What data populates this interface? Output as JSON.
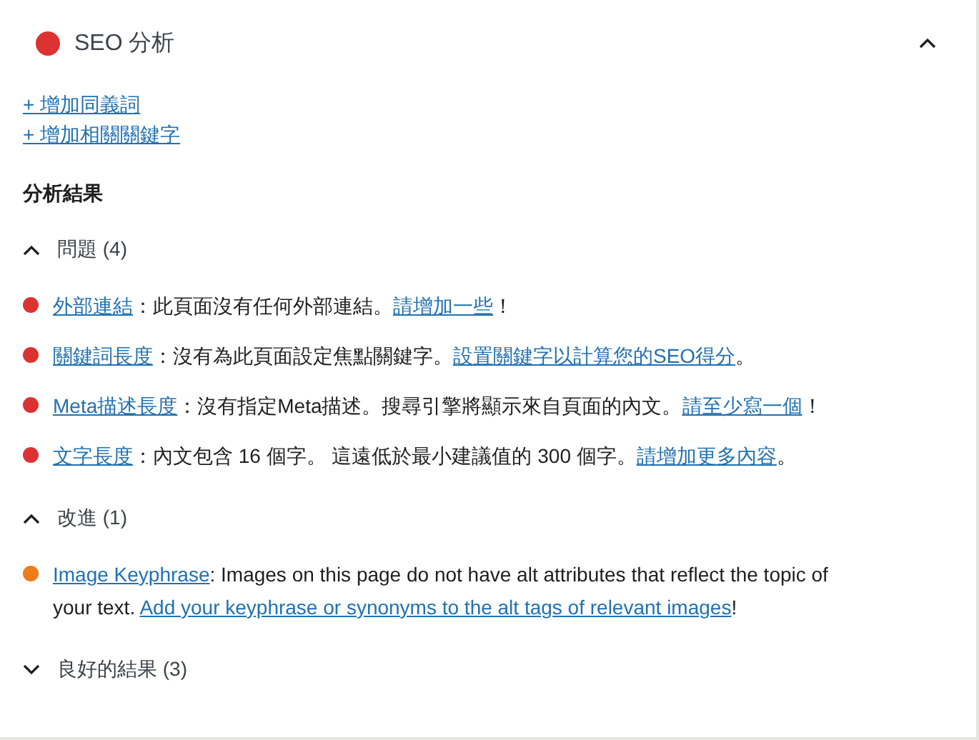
{
  "panel": {
    "title": "SEO 分析",
    "color": "#dc3232",
    "expanded": true
  },
  "links": [
    "+ 增加同義詞",
    "+ 增加相關關鍵字"
  ],
  "results_heading": "分析結果",
  "groups": [
    {
      "title": "問題 (4)",
      "expanded": true,
      "items": [
        {
          "color": "#dc3232",
          "parts": [
            {
              "kind": "link",
              "text": "外部連結"
            },
            {
              "kind": "text",
              "text": "：此頁面沒有任何外部連結。"
            },
            {
              "kind": "link",
              "text": "請增加一些"
            },
            {
              "kind": "text",
              "text": "！"
            }
          ]
        },
        {
          "color": "#dc3232",
          "parts": [
            {
              "kind": "link",
              "text": "關鍵詞長度"
            },
            {
              "kind": "text",
              "text": "：沒有為此頁面設定焦點關鍵字。"
            },
            {
              "kind": "link",
              "text": "設置關鍵字以計算您的SEO得分"
            },
            {
              "kind": "text",
              "text": "。"
            }
          ]
        },
        {
          "color": "#dc3232",
          "parts": [
            {
              "kind": "link",
              "text": "Meta描述長度"
            },
            {
              "kind": "text",
              "text": "：沒有指定Meta描述。搜尋引擎將顯示來自頁面的內文。"
            },
            {
              "kind": "link",
              "text": "請至少寫一個"
            },
            {
              "kind": "text",
              "text": "！"
            }
          ]
        },
        {
          "color": "#dc3232",
          "parts": [
            {
              "kind": "link",
              "text": "文字長度"
            },
            {
              "kind": "text",
              "text": "：內文包含 16 個字。 這遠低於最小建議值的 300 個字。"
            },
            {
              "kind": "link",
              "text": "請增加更多內容"
            },
            {
              "kind": "text",
              "text": "。"
            }
          ]
        }
      ]
    },
    {
      "title": "改進 (1)",
      "expanded": true,
      "items": [
        {
          "color": "#ee7c1b",
          "parts": [
            {
              "kind": "link",
              "text": "Image Keyphrase"
            },
            {
              "kind": "text",
              "text": ": Images on this page do not have alt attributes that reflect the topic of your text. "
            },
            {
              "kind": "link",
              "text": "Add your keyphrase or synonyms to the alt tags of relevant images"
            },
            {
              "kind": "text",
              "text": "!"
            }
          ]
        }
      ]
    },
    {
      "title": "良好的結果 (3)",
      "expanded": false
    }
  ]
}
